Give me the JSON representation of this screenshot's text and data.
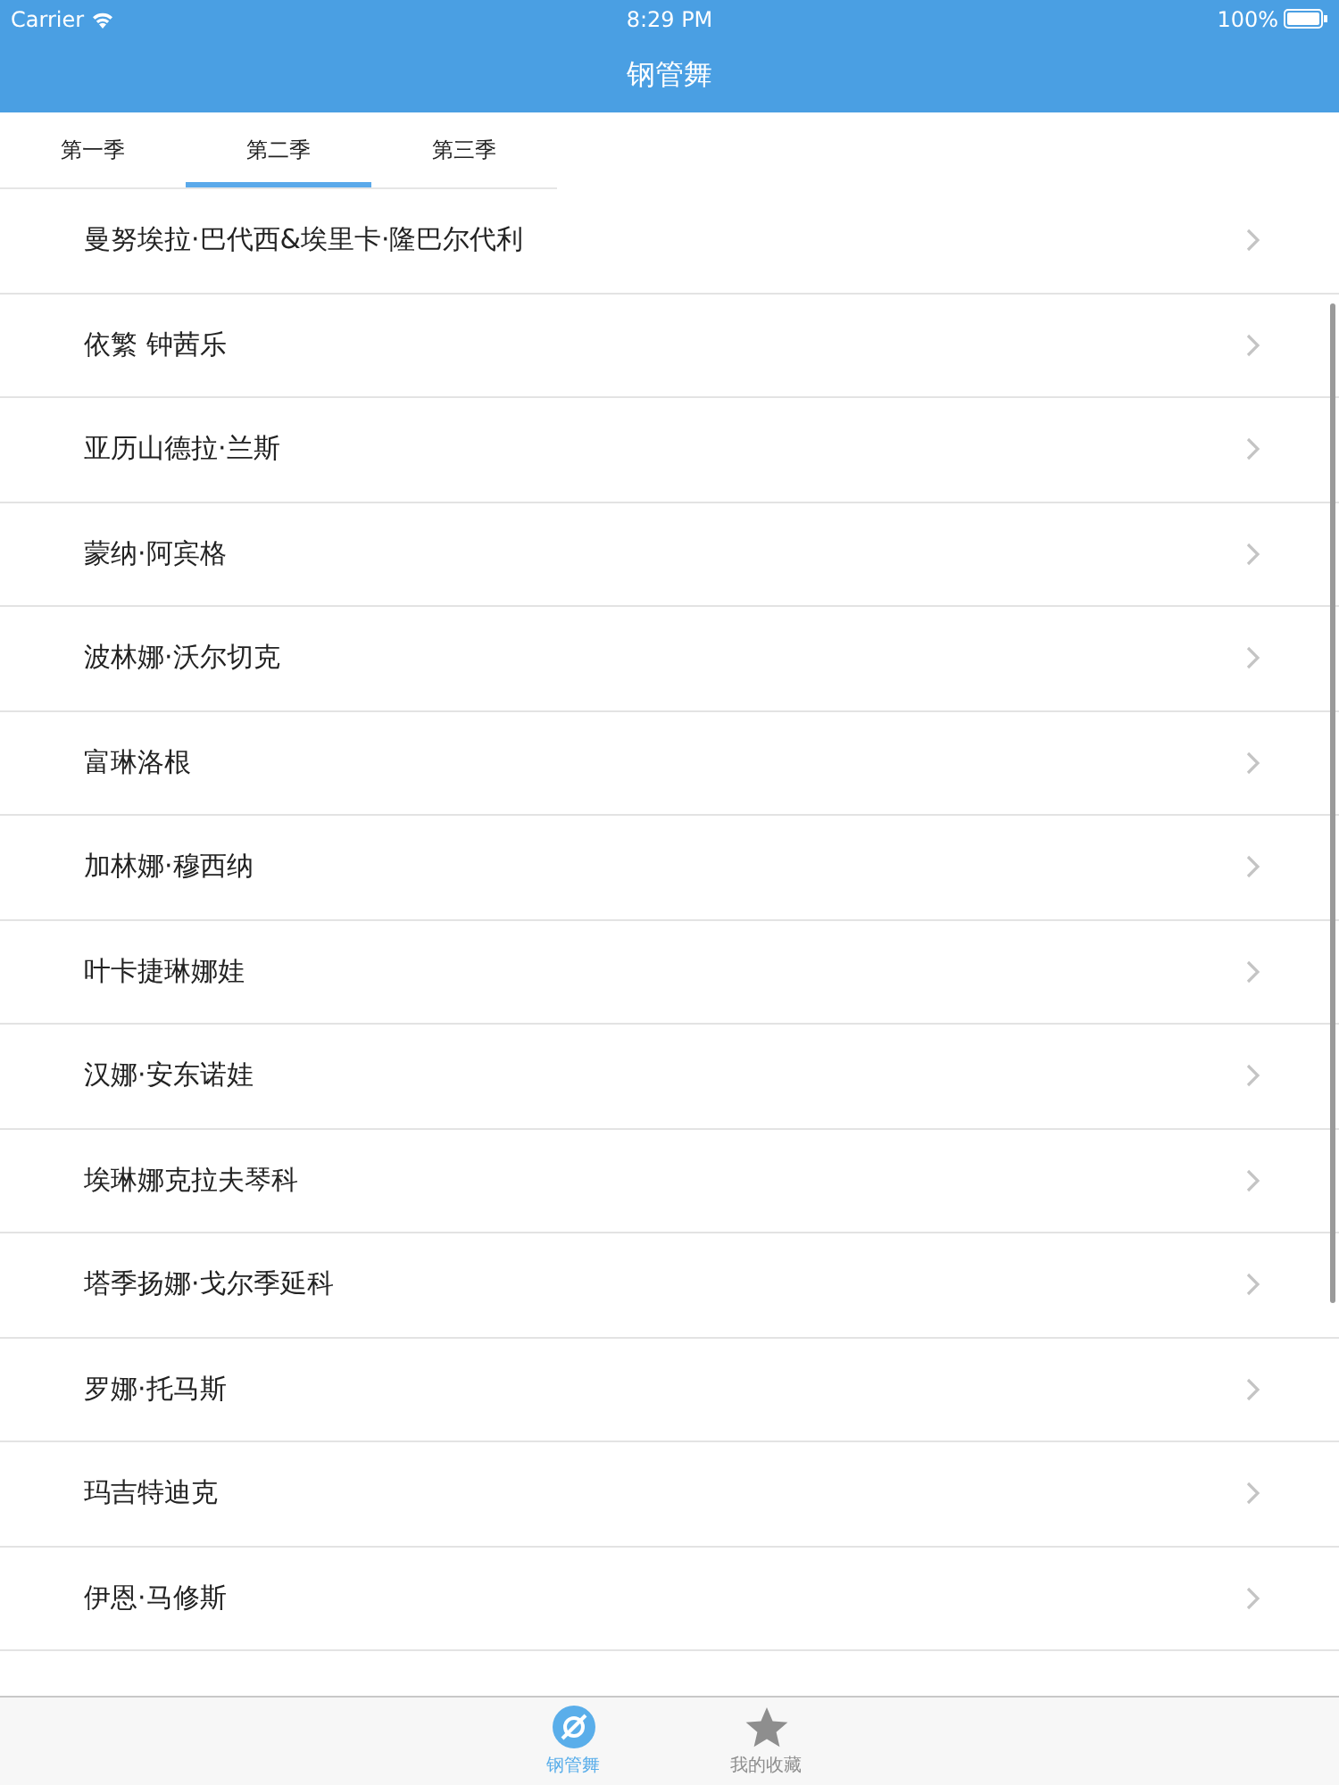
{
  "status_bar": {
    "carrier": "Carrier",
    "time": "8:29 PM",
    "battery": "100%"
  },
  "nav_bar": {
    "title": "钢管舞"
  },
  "tabs": [
    {
      "label": "第一季",
      "selected": false
    },
    {
      "label": "第二季",
      "selected": true
    },
    {
      "label": "第三季",
      "selected": false
    }
  ],
  "list": {
    "items": [
      {
        "name": "曼努埃拉·巴代西&埃里卡·隆巴尔代利"
      },
      {
        "name": "依繁 钟茜乐"
      },
      {
        "name": "亚历山德拉·兰斯"
      },
      {
        "name": "蒙纳·阿宾格"
      },
      {
        "name": "波林娜·沃尔切克"
      },
      {
        "name": "富琳洛根"
      },
      {
        "name": "加林娜·穆西纳"
      },
      {
        "name": "叶卡捷琳娜娃"
      },
      {
        "name": "汉娜·安东诺娃"
      },
      {
        "name": "埃琳娜克拉夫琴科"
      },
      {
        "name": "塔季扬娜·戈尔季延科"
      },
      {
        "name": "罗娜·托马斯"
      },
      {
        "name": "玛吉特迪克"
      },
      {
        "name": "伊恩·马修斯"
      }
    ]
  },
  "tab_bar": {
    "items": [
      {
        "label": "钢管舞",
        "selected": true
      },
      {
        "label": "我的收藏",
        "selected": false
      }
    ]
  }
}
